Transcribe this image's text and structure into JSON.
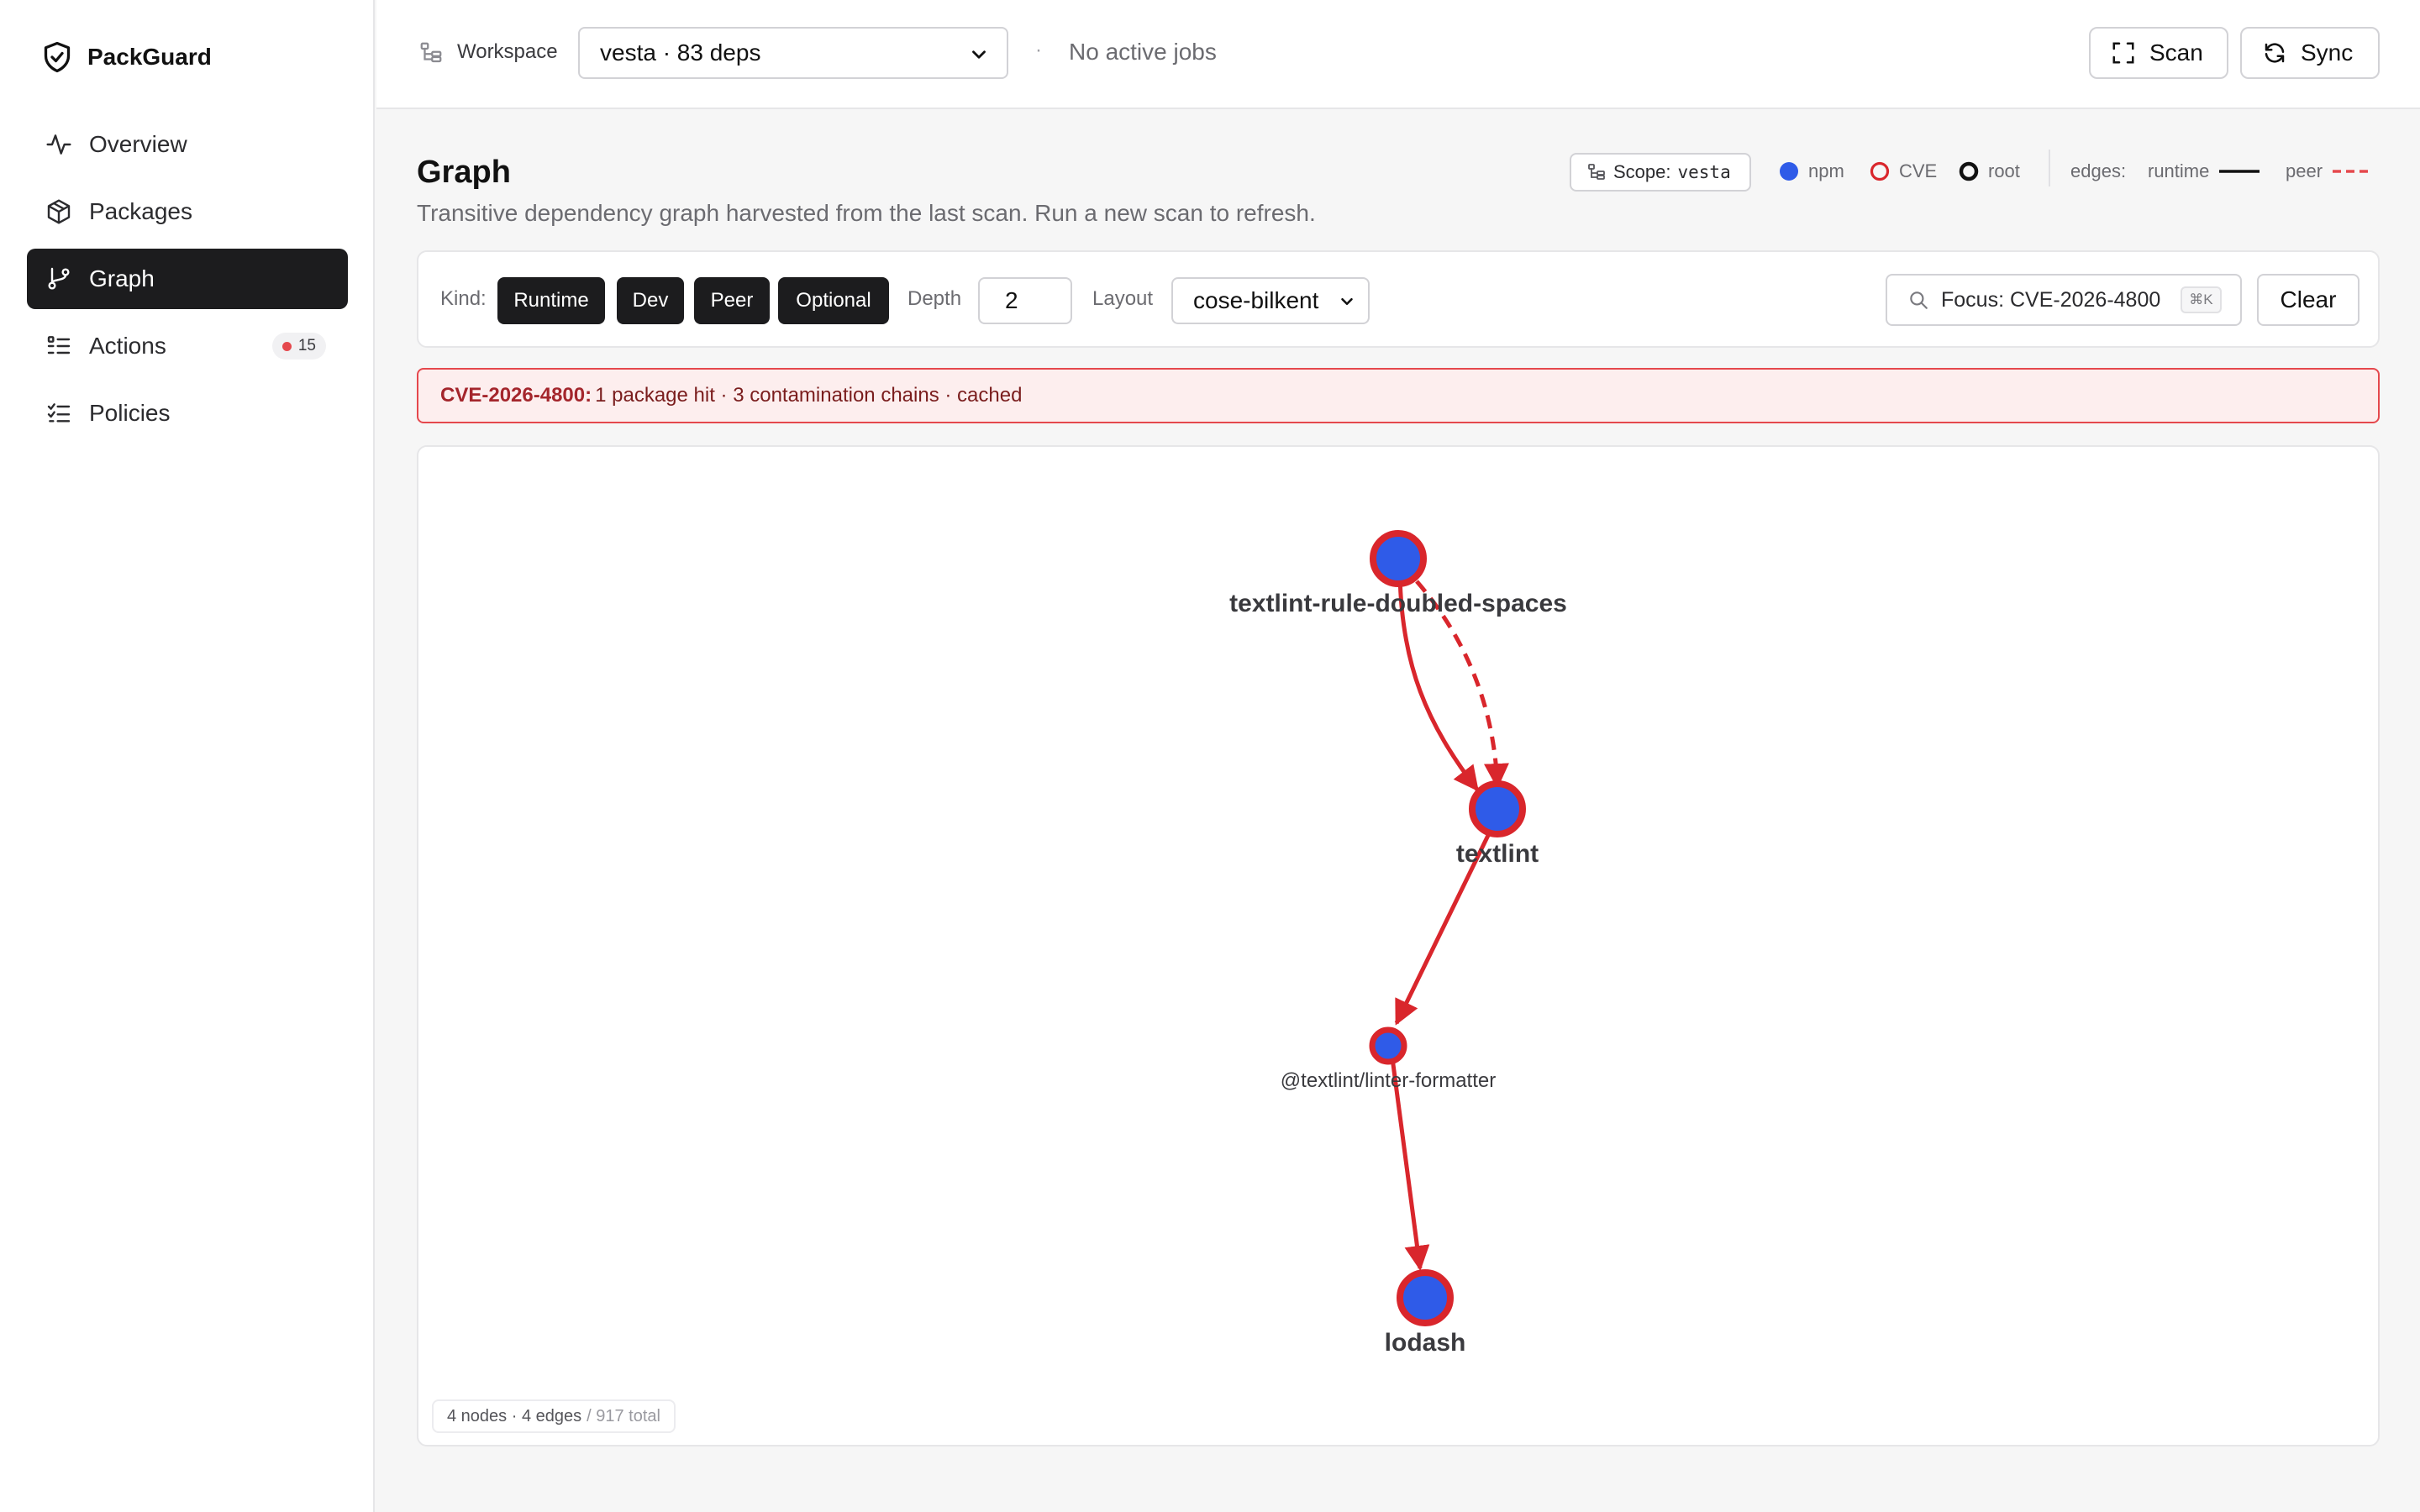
{
  "app": {
    "name": "PackGuard"
  },
  "sidebar": {
    "items": [
      {
        "label": "Overview",
        "icon": "activity-icon"
      },
      {
        "label": "Packages",
        "icon": "package-icon"
      },
      {
        "label": "Graph",
        "icon": "git-branch-icon",
        "active": true
      },
      {
        "label": "Actions",
        "icon": "list-icon",
        "badge": "15"
      },
      {
        "label": "Policies",
        "icon": "list-checks-icon"
      }
    ]
  },
  "topbar": {
    "workspace_label": "Workspace",
    "workspace_value": "vesta · 83 deps",
    "separator": "·",
    "jobs_status": "No active jobs",
    "scan_label": "Scan",
    "sync_label": "Sync"
  },
  "page": {
    "title": "Graph",
    "subtitle": "Transitive dependency graph harvested from the last scan. Run a new scan to refresh.",
    "scope_label": "Scope:",
    "scope_value": "vesta"
  },
  "legend": {
    "npm": "npm",
    "cve": "CVE",
    "root": "root",
    "edges": "edges:",
    "runtime": "runtime",
    "peer": "peer"
  },
  "toolbar": {
    "kind_label": "Kind:",
    "kinds": [
      "Runtime",
      "Dev",
      "Peer",
      "Optional"
    ],
    "depth_label": "Depth",
    "depth_value": "2",
    "layout_label": "Layout",
    "layout_value": "cose-bilkent",
    "focus_value": "Focus: CVE-2026-4800",
    "focus_shortcut": "⌘K",
    "clear_label": "Clear"
  },
  "alert": {
    "cve": "CVE-2026-4800:",
    "message": "1 package hit · 3 contamination chains · cached"
  },
  "graph": {
    "nodes": [
      {
        "id": "n1",
        "label": "textlint-rule-doubled-spaces"
      },
      {
        "id": "n2",
        "label": "textlint"
      },
      {
        "id": "n3",
        "label": "@textlint/linter-formatter"
      },
      {
        "id": "n4",
        "label": "lodash"
      }
    ],
    "edges": [
      {
        "from": "n1",
        "to": "n2",
        "kind": "runtime"
      },
      {
        "from": "n1",
        "to": "n2",
        "kind": "peer"
      },
      {
        "from": "n2",
        "to": "n3",
        "kind": "runtime"
      },
      {
        "from": "n3",
        "to": "n4",
        "kind": "runtime"
      }
    ],
    "stats": "4 nodes · 4 edges",
    "stats_total": "/ 917 total"
  },
  "colors": {
    "npm": "#2f5be8",
    "cve": "#d9262c",
    "root": "#111111",
    "peer_edge": "#e5484d",
    "active_nav": "#1c1c1e"
  }
}
